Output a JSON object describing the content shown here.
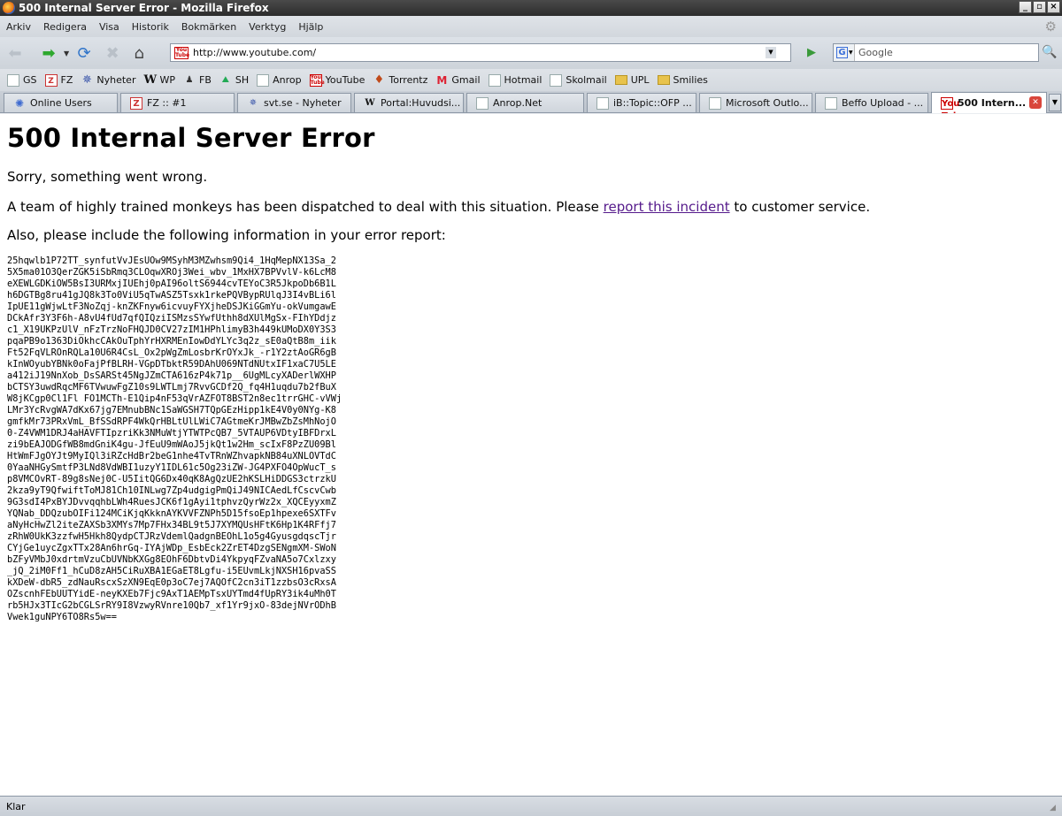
{
  "window": {
    "title": "500 Internal Server Error - Mozilla Firefox"
  },
  "menu": [
    "Arkiv",
    "Redigera",
    "Visa",
    "Historik",
    "Bokmärken",
    "Verktyg",
    "Hjälp"
  ],
  "navbar": {
    "url": "http://www.youtube.com/",
    "search_placeholder": "Google"
  },
  "bookmarks": [
    {
      "label": "GS",
      "icon": "page-icon"
    },
    {
      "label": "FZ",
      "icon": "fz-icon"
    },
    {
      "label": "Nyheter",
      "icon": "star-icon"
    },
    {
      "label": "WP",
      "icon": "wikipedia-icon"
    },
    {
      "label": "FB",
      "icon": "fb-icon"
    },
    {
      "label": "SH",
      "icon": "sh-icon"
    },
    {
      "label": "Anrop",
      "icon": "page-icon"
    },
    {
      "label": "YouTube",
      "icon": "youtube-icon"
    },
    {
      "label": "Torrentz",
      "icon": "torrentz-icon"
    },
    {
      "label": "Gmail",
      "icon": "gmail-icon"
    },
    {
      "label": "Hotmail",
      "icon": "page-icon"
    },
    {
      "label": "Skolmail",
      "icon": "page-icon"
    },
    {
      "label": "UPL",
      "icon": "folder-icon"
    },
    {
      "label": "Smilies",
      "icon": "folder-icon"
    }
  ],
  "tabs": [
    {
      "label": "Online Users"
    },
    {
      "label": "FZ :: #1"
    },
    {
      "label": "svt.se - Nyheter"
    },
    {
      "label": "Portal:Huvudsi..."
    },
    {
      "label": "Anrop.Net"
    },
    {
      "label": "iB::Topic::OFP ..."
    },
    {
      "label": "Microsoft Outlo..."
    },
    {
      "label": "Beffo Upload - ..."
    },
    {
      "label": "500 Intern..."
    }
  ],
  "page": {
    "heading": "500 Internal Server Error",
    "sorry": "Sorry, something went wrong.",
    "monkeys_before": "A team of highly trained monkeys has been dispatched to deal with this situation. Please ",
    "link_text": "report this incident",
    "monkeys_after": " to customer service.",
    "also": "Also, please include the following information in your error report:",
    "error_code": "25hqwlb1P72TT_synfutVvJEsUOw9MSyhM3MZwhsm9Qi4_1HqMepNX13Sa_2\n5X5ma01O3QerZGK5iSbRmq3CLOqwXROj3Wei_wbv_1MxHX7BPVvlV-k6LcM8\neXEWLGDKiOW5BsI3URMxjIUEhj0pAI96oltS6944cvTEYoC3R5JkpoDb6B1L\nh6DGTBg8ru41gJQ8k3To0ViU5qTwASZ5Tsxk1rkePQVBypRUlqJ3I4vBLi6l\nIpUE11gWjwLtF3NoZqj-knZKFnyw6icvuyFYXjheDSJKiGGmYu-okVumgawE\nDCkAfr3Y3F6h-A8vU4fUd7qfQIQziISMzsSYwfUthh8dXUlMgSx-FIhYDdjz\nc1_X19UKPzUlV_nFzTrzNoFHQJD0CV27zIM1HPhlimyB3h449kUMoDX0Y3S3\npqaPB9o1363DiOkhcCAkOuTphYrHXRMEnIowDdYLYc3q2z_sE0aQtB8m_iik\nFt52FqVLROnRQLa10U6R4CsL_Ox2pWgZmLosbrKrOYxJk_-r1Y2ztAoGR6gB\nkInWOyubYBNk0oFajPfBLRH-VGpDTbktR59DAhU069NTdNUtxIF1xaC7U5LE\na412iJ19NnXob_DsSARSt45NgJZmCTA616zP4k71p__6UgMLcyXADerlWXHP\nbCTSY3uwdRqcMF6TVwuwFgZ10s9LWTLmj7RvvGCDf2Q_fq4H1uqdu7b2fBuX\nW8jKCgp0Cl1Fl FO1MCTh-E1Qip4nF53qVrAZFOT8BST2n8ec1trrGHC-vVWj\nLMr3YcRvgWA7dKx67jg7EMnubBNc1SaWGSH7TQpGEzHipp1kE4V0y0NYg-K8\ngmfkMr73PRxVmL_BfSSdRPF4WkQrHBLtUlLWiC7AGtmeKrJMBwZbZsMhNojO\n0-Z4VWM1DRJ4aHAVFTIpzriKk3NMuWtjYTWTPcQB7_5VTAUP6VDtyIBFDrxL\nzi9bEAJODGfWB8mdGniK4gu-JfEuU9mWAoJ5jkQt1w2Hm_scIxF8PzZU09Bl\nHtWmFJgOYJt9MyIQl3iRZcHdBr2beG1nhe4TvTRnWZhvapkNB84uXNLOVTdC\n0YaaNHGySmtfP3LNd8VdWBI1uzyY1IDL61c5Og23iZW-JG4PXFO4OpWucT_s\np8VMCOvRT-89g8sNej0C-U5IitQG6Dx40qK8AgQzUE2hKSLHiDDGS3ctrzkU\n2kza9yT9QfwiftToMJ81Ch10INLwg7Zp4udgigPmQiJ49NICAedLfCscvCwb\n9G3sdI4PxBYJDvvqqhbLWh4RuesJCK6f1gAyi1tphvzQyrWz2x_XQCEyyxmZ\nYQNab_DDQzubOIFi124MCiKjqKkknAYKVVFZNPh5D15fsoEp1hpexe6SXTFv\naNyHcHwZl2iteZAXSb3XMYs7Mp7FHx34BL9t5J7XYMQUsHFtK6Hp1K4RFfj7\nzRhW0UkK3zzfwH5Hkh8QydpCTJRzVdemlQadgnBEOhL1o5g4GyusgdqscTjr\nCYjGe1uycZgxTTx28An6hrGq-IYAjWDp_EsbEck2ZrET4DzgSENgmXM-SWoN\nbZFyVMbJ0xdrtmVzuCbUVNbKXGg8EOhF6DbtvDi4YkpyqFZvaNA5o7Cxlzxy\n_jQ_2iM0Ff1_hCuD8zAH5CiRuXBA1EGaET8Lgfu-i5EUvmLkjNXSH16pvaSS\nkXDeW-dbR5_zdNauRscxSzXN9EqE0p3oC7ej7AQOfC2cn3iT1zzbsO3cRxsA\nOZscnhFEbUUTYidE-neyKXEb7Fjc9AxT1AEMpTsxUYTmd4fUpRY3ik4uMh0T\nrb5HJx3TIcG2bCGLSrRY9I8VzwyRVnre10Qb7_xf1Yr9jxO-83dejNVrODhB\nVwek1guNPY6TO8Rs5w=="
  },
  "status": {
    "text": "Klar"
  }
}
